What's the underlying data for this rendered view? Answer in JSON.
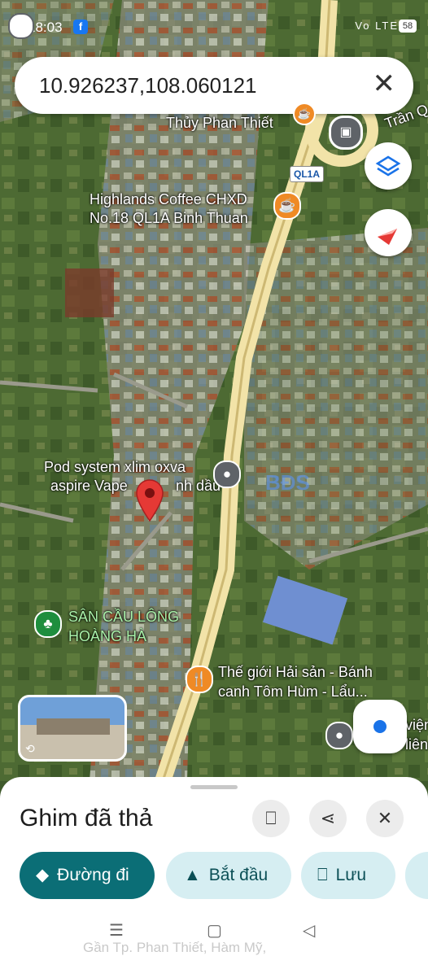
{
  "status_bar": {
    "time": "18:03",
    "app_badge": "f",
    "network": "Vo LTE",
    "battery": "58"
  },
  "search": {
    "query": "10.926237,108.060121",
    "clear_icon": "close-icon"
  },
  "map": {
    "labels": {
      "thuy_phan_thiet": "Thủy Phan Thiết",
      "tran_q": "Trần Q",
      "road_shield": "QL1A",
      "highlands_1": "Highlands Coffee CHXD",
      "highlands_2": "No.18 QL1A Binh Thuan",
      "pod_1": "Pod system xlim oxva",
      "pod_2": "aspire Vape",
      "pod_2b": "nh dầu",
      "watermark": "BĐS",
      "san_1": "SÂN CẦU LÔNG",
      "san_2": "HOÀNG HÀ",
      "the_gioi_1": "Thế giới Hải sản - Bánh",
      "the_gioi_2": "canh Tôm Hùm - Lẩu...",
      "edge_1": "viện",
      "edge_2": "liên"
    },
    "colors": {
      "road": "#d9c88a",
      "pin": "#e53935",
      "poi_orange": "#ef8a25",
      "poi_green": "#1e8e3e",
      "poi_gray": "#5f6368"
    }
  },
  "sheet": {
    "title": "Ghim đã thả",
    "actions": {
      "directions": "Đường đi",
      "start": "Bắt đầu",
      "save": "Lưu"
    }
  },
  "behind_text": "Gần Tp. Phan Thiết, Hàm Mỹ,"
}
